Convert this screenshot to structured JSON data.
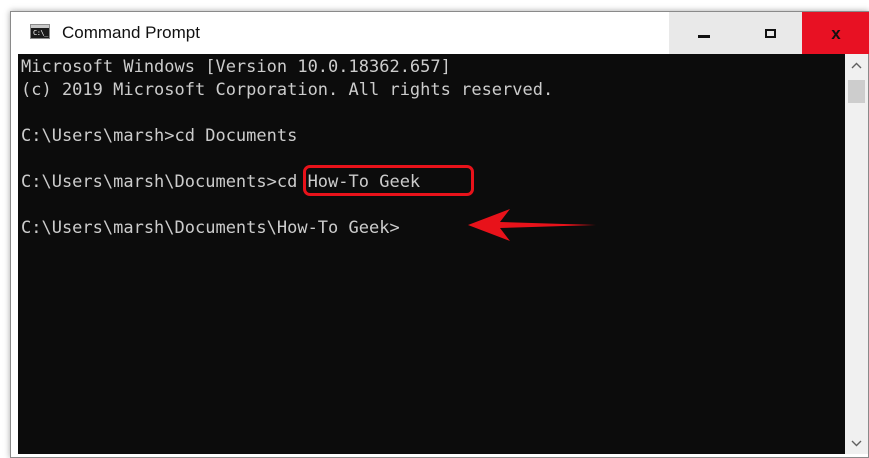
{
  "window": {
    "title": "Command Prompt",
    "icon": "command-prompt-icon",
    "icon_glyph": "C:\\_"
  },
  "controls": {
    "minimize_icon": "minimize-icon",
    "maximize_icon": "maximize-icon",
    "close_icon": "close-icon",
    "close_glyph": "x",
    "close_color": "#e81123"
  },
  "console": {
    "background": "#0c0c0c",
    "text_color": "#cccccc",
    "lines": [
      "Microsoft Windows [Version 10.0.18362.657]",
      "(c) 2019 Microsoft Corporation. All rights reserved.",
      "C:\\Users\\marsh>cd Documents",
      "C:\\Users\\marsh\\Documents>cd How-To Geek",
      "C:\\Users\\marsh\\Documents\\How-To Geek>"
    ],
    "highlighted_command": "cd How-To Geek",
    "annotation_color": "#e8121a"
  },
  "scrollbar": {
    "up_icon": "scroll-up-arrow-icon",
    "down_icon": "scroll-down-arrow-icon"
  }
}
